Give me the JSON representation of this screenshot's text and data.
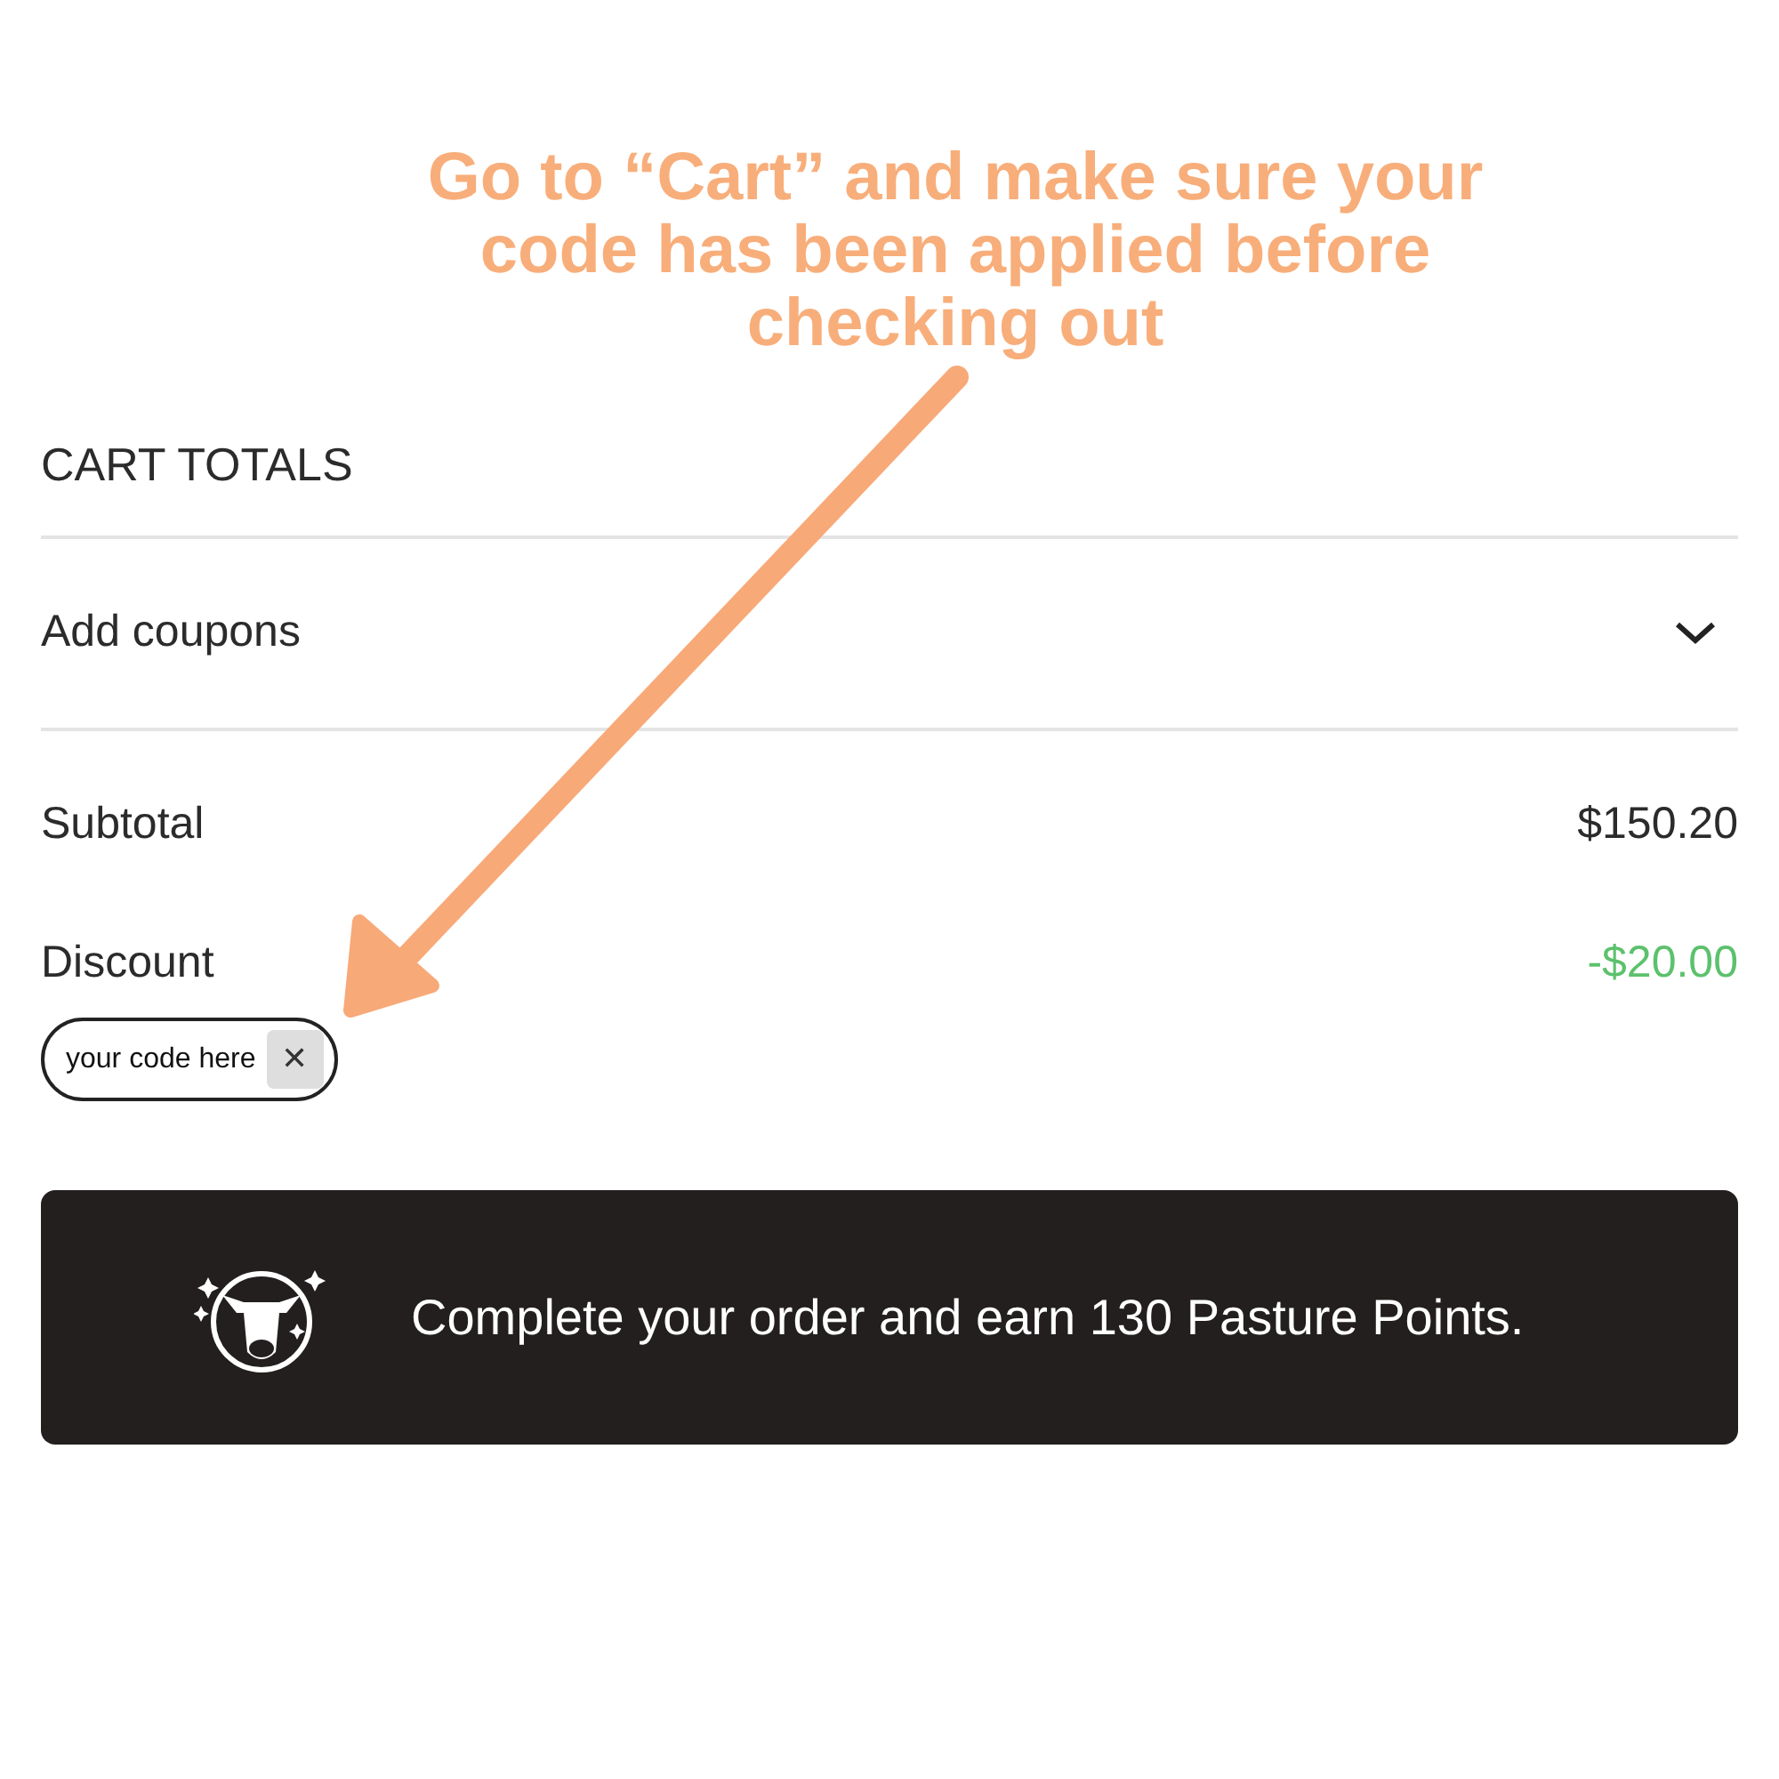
{
  "annotation": "Go to “Cart” and make sure your code has been applied before checking out",
  "cart_totals": {
    "title": "CART TOTALS",
    "coupons": {
      "label": "Add coupons",
      "expanded": false
    },
    "subtotal": {
      "label": "Subtotal",
      "value": "$150.20"
    },
    "discount": {
      "label": "Discount",
      "value": "-$20.00",
      "color": "#5cc16c"
    },
    "coupon_chip": {
      "code": "your code here",
      "remove": "✕"
    }
  },
  "points_banner": {
    "message": "Complete your order and earn 130 Pasture Points."
  }
}
